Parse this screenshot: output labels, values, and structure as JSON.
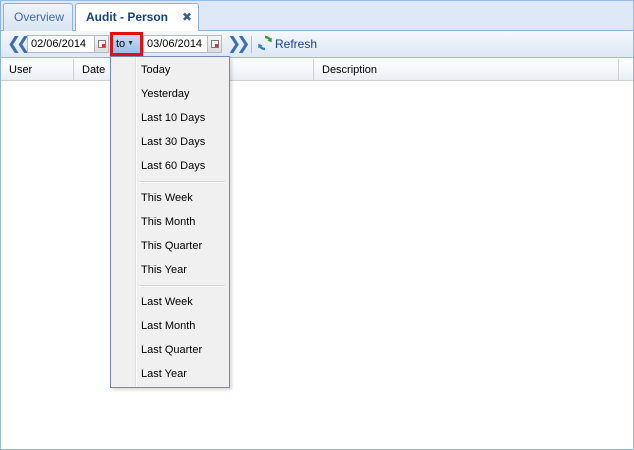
{
  "tabs": [
    {
      "label": "Overview",
      "active": false
    },
    {
      "label": "Audit - Person",
      "active": true,
      "closable": true
    }
  ],
  "toolbar": {
    "prev_icon": "double-chevron-left-icon",
    "next_icon": "double-chevron-right-icon",
    "start_date": "02/06/2014",
    "range_button_label": "to",
    "end_date": "03/06/2014",
    "refresh_label": "Refresh",
    "refresh_icon": "refresh-icon",
    "highlight_color": "#e01010"
  },
  "grid": {
    "columns": [
      {
        "label": "User"
      },
      {
        "label": "Date"
      },
      {
        "label": ""
      },
      {
        "label": "Description"
      }
    ],
    "rows": []
  },
  "range_menu": {
    "groups": [
      {
        "items": [
          "Today",
          "Yesterday",
          "Last 10 Days",
          "Last 30 Days",
          "Last 60 Days"
        ]
      },
      {
        "items": [
          "This Week",
          "This Month",
          "This Quarter",
          "This Year"
        ]
      },
      {
        "items": [
          "Last Week",
          "Last Month",
          "Last Quarter",
          "Last Year"
        ]
      }
    ]
  }
}
